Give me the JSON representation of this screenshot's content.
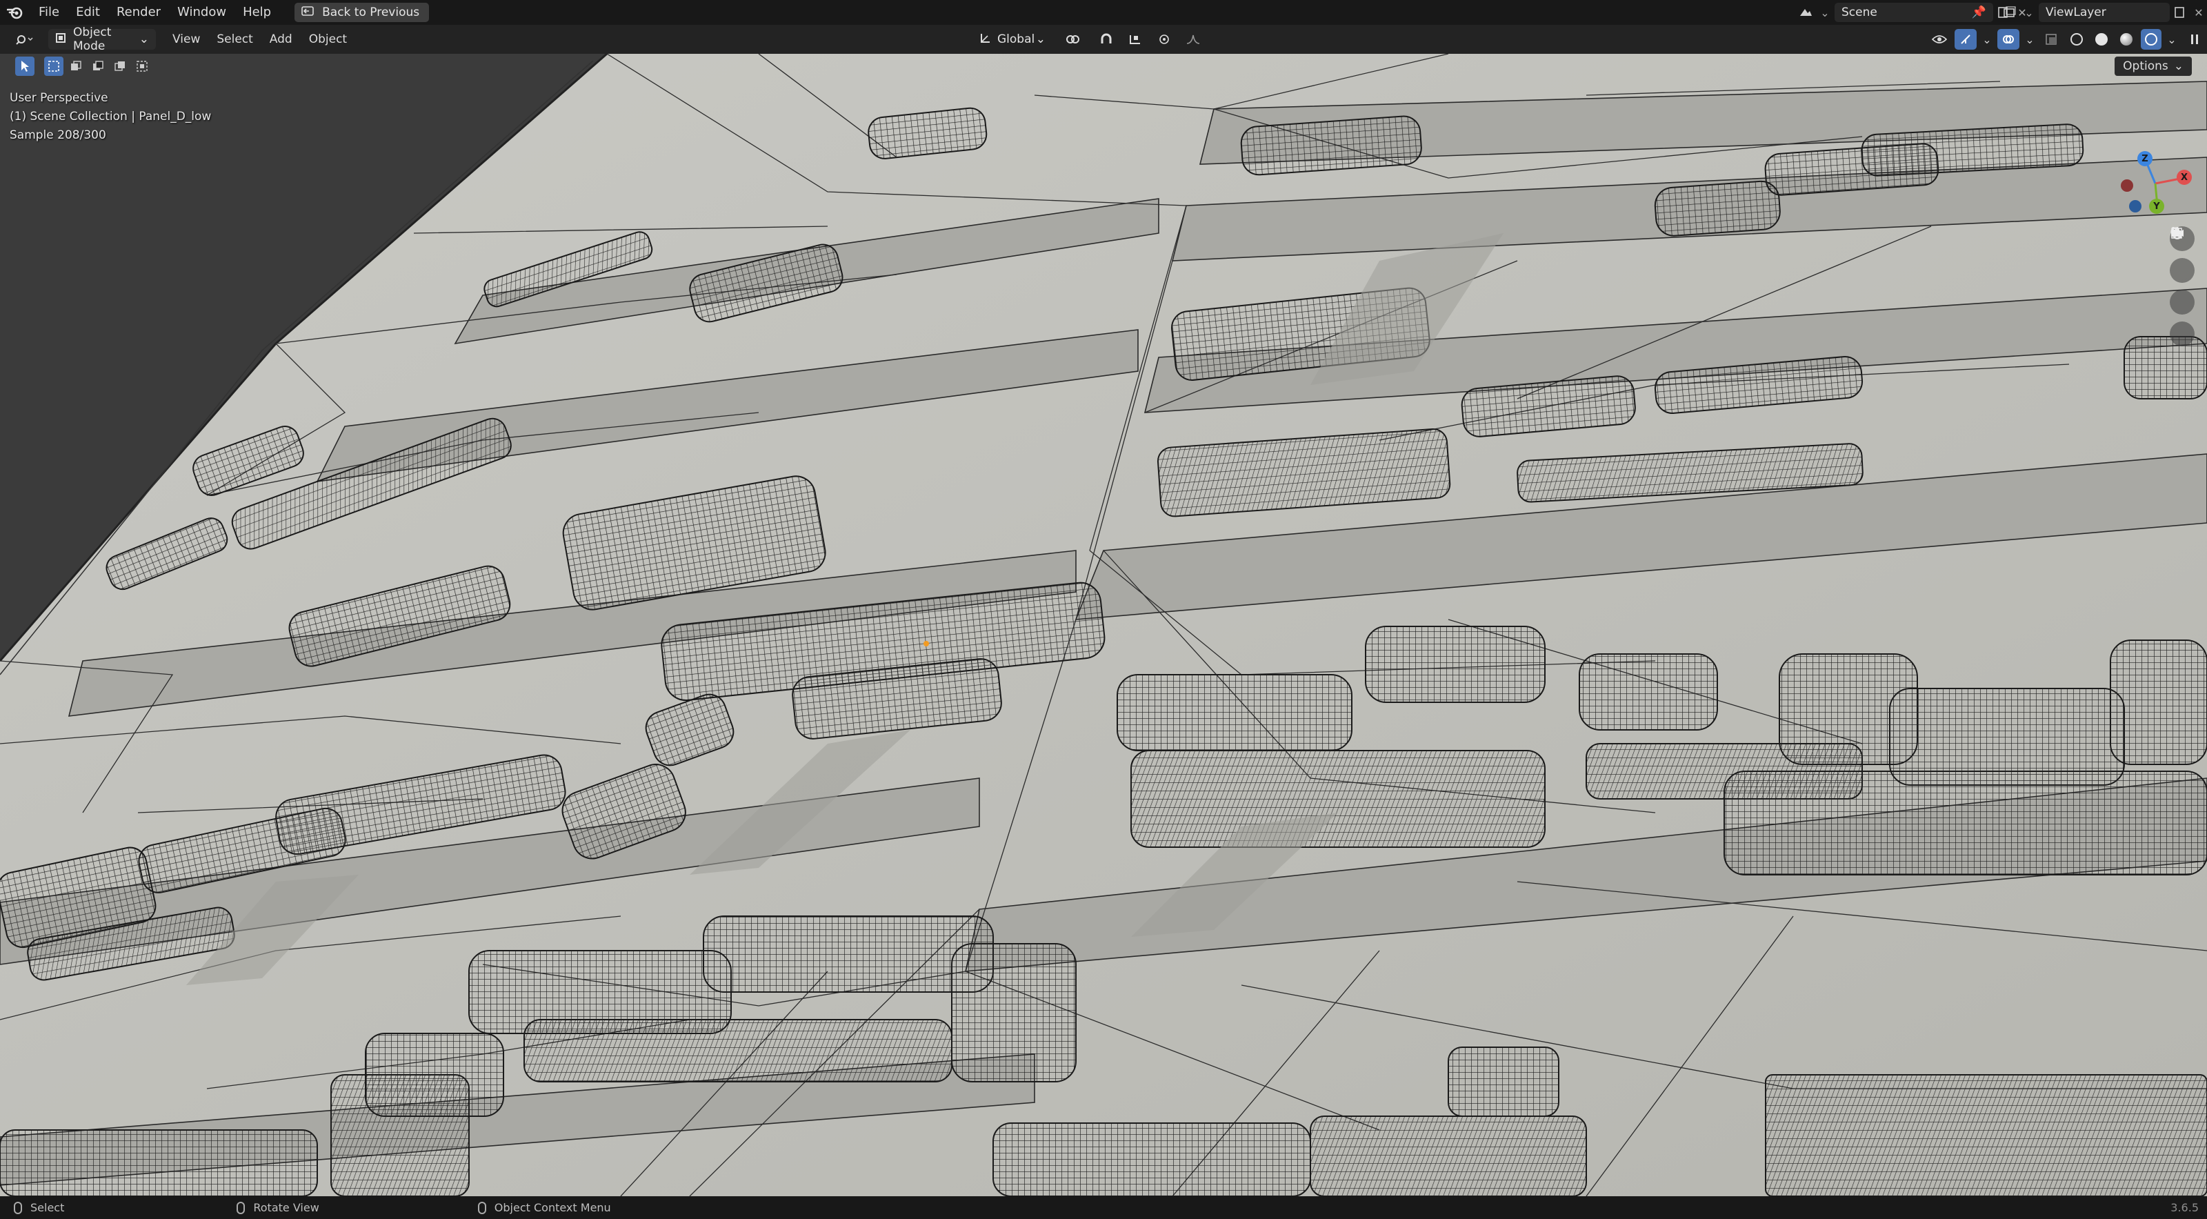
{
  "menu": {
    "items": [
      "File",
      "Edit",
      "Render",
      "Window",
      "Help"
    ],
    "back_label": "Back to Previous"
  },
  "scene": {
    "label": "Scene"
  },
  "view_layer": {
    "label": "ViewLayer"
  },
  "header": {
    "mode": "Object Mode",
    "menus": [
      "View",
      "Select",
      "Add",
      "Object"
    ],
    "orientation": "Global"
  },
  "toolbar": {
    "options_label": "Options"
  },
  "viewport": {
    "perspective": "User Perspective",
    "collection": "(1) Scene Collection | Panel_D_low",
    "sample": "Sample 208/300"
  },
  "gizmo": {
    "z": "Z",
    "x": "X",
    "y": "Y"
  },
  "status": {
    "select": "Select",
    "rotate": "Rotate View",
    "context": "Object Context Menu",
    "version": "3.6.5"
  },
  "colors": {
    "accent": "#4772b3",
    "axis_x": "#e0504f",
    "axis_y": "#7ab32b",
    "axis_z": "#3b85e0",
    "surface": "#bfbfba"
  }
}
